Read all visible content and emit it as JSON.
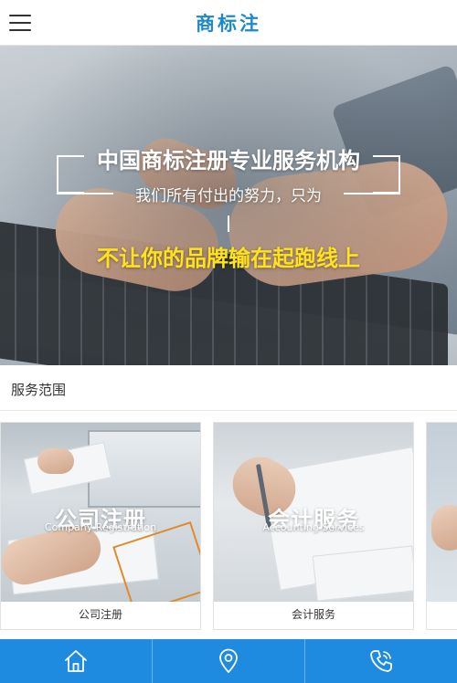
{
  "header": {
    "logo_text": "商标注",
    "menu_icon": "hamburger-menu-icon"
  },
  "banner": {
    "title": "中国商标注册专业服务机构",
    "subtitle": "我们所有付出的努力，只为",
    "slogan": "不让你的品牌输在起跑线上",
    "slogan_color": "#ffe21a",
    "slides": 2,
    "active_slide": 2
  },
  "section": {
    "title": "服务范围"
  },
  "services": [
    {
      "title": "公司注册",
      "subtitle": "Company Registration",
      "caption": "公司注册"
    },
    {
      "title": "会计服务",
      "subtitle": "Accounting Services",
      "caption": "会计服务"
    }
  ],
  "bottom_nav": {
    "color": "#1e8be0",
    "items": [
      {
        "icon": "home-icon"
      },
      {
        "icon": "location-pin-icon"
      },
      {
        "icon": "phone-call-icon"
      }
    ]
  },
  "colors": {
    "brand": "#1e88c8"
  }
}
